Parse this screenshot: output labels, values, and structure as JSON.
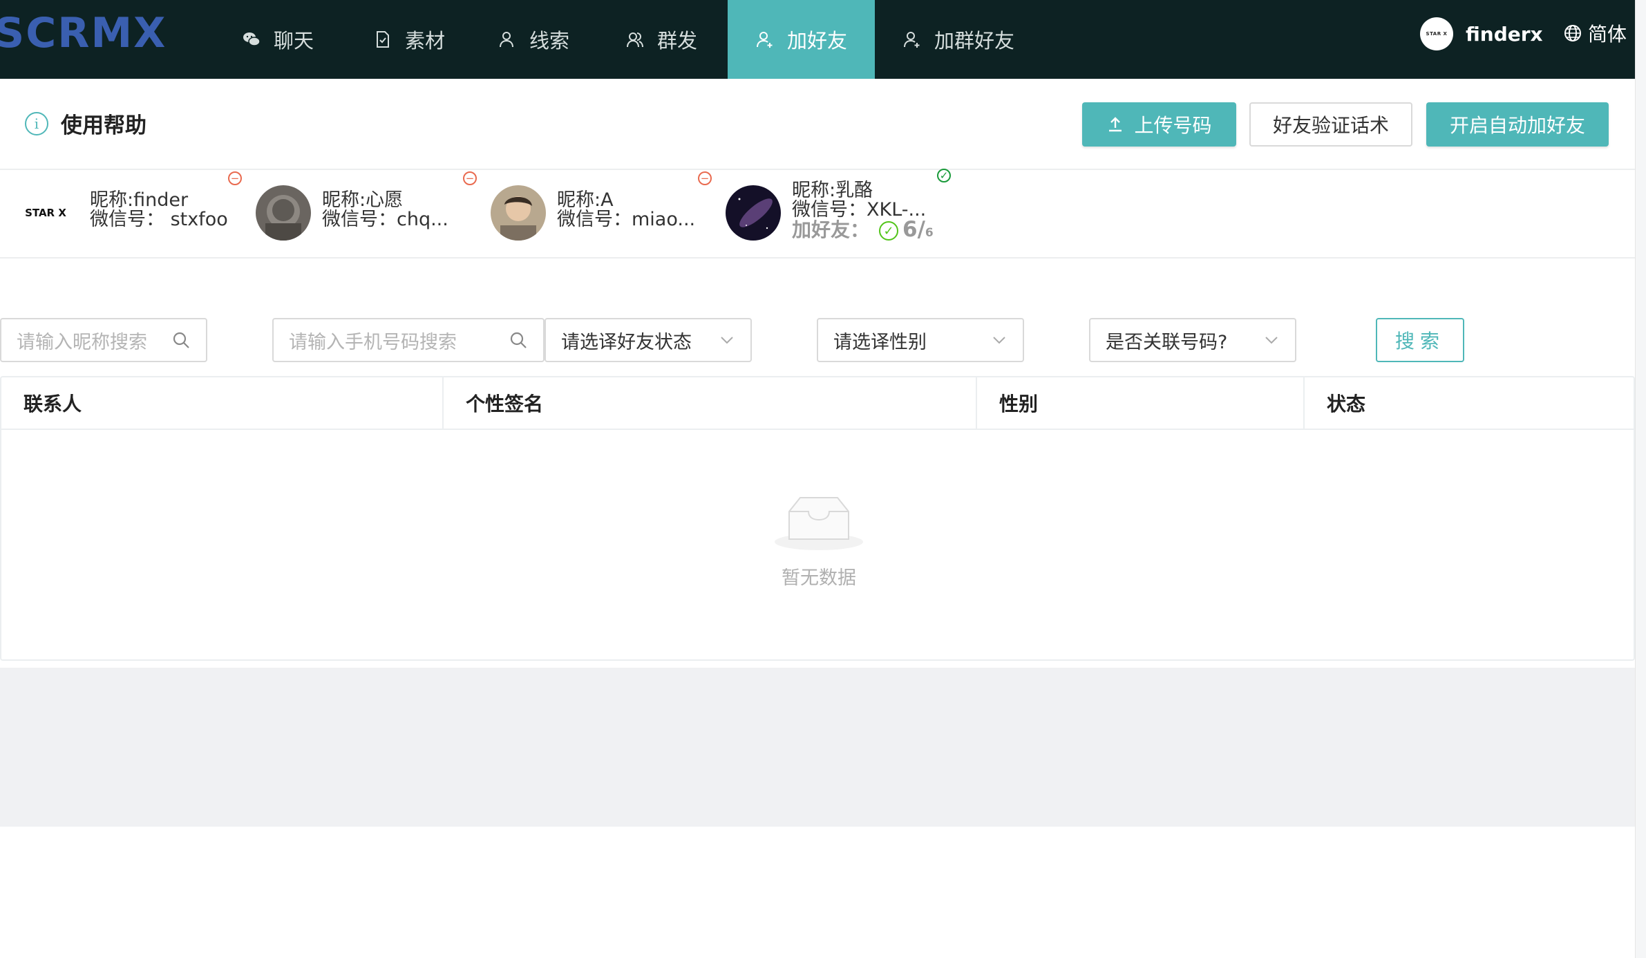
{
  "brand": {
    "logo_text": "SCRMX",
    "accent": "#4fb7b8",
    "nav_bg": "#0d2223"
  },
  "nav": {
    "items": [
      {
        "label": "聊天",
        "icon": "wechat-icon"
      },
      {
        "label": "素材",
        "icon": "document-icon"
      },
      {
        "label": "线索",
        "icon": "user-icon"
      },
      {
        "label": "群发",
        "icon": "users-icon"
      },
      {
        "label": "加好友",
        "icon": "user-add-icon",
        "active": true
      },
      {
        "label": "加群好友",
        "icon": "user-add-icon"
      }
    ],
    "user": {
      "avatar_text": "STAR X",
      "name": "finderx"
    },
    "language": "简体"
  },
  "header": {
    "help_label": "使用帮助",
    "buttons": {
      "upload": "上传号码",
      "verify_script": "好友验证话术",
      "auto_add": "开启自动加好友"
    }
  },
  "accounts": [
    {
      "nickname": "昵称:finder",
      "wechat": "微信号： stxfoo",
      "status": "offline",
      "avatar_text": "STAR X"
    },
    {
      "nickname": "昵称:心愿",
      "wechat": "微信号：chq...",
      "status": "offline"
    },
    {
      "nickname": "昵称:A",
      "wechat": "微信号：miao...",
      "status": "offline"
    },
    {
      "nickname": "昵称:乳酪",
      "wechat": "微信号：XKL-...",
      "status": "online",
      "add_label": "加好友：",
      "add_count": "6",
      "add_total": "6"
    }
  ],
  "filters": {
    "nickname_placeholder": "请输入昵称搜索",
    "phone_placeholder": "请输入手机号码搜索",
    "friend_status": "请选译好友状态",
    "gender": "请选译性别",
    "linked": "是否关联号码?",
    "search_label": "搜索"
  },
  "table": {
    "columns": [
      "联系人",
      "个性签名",
      "性别",
      "状态"
    ],
    "rows": [],
    "empty_text": "暂无数据"
  }
}
